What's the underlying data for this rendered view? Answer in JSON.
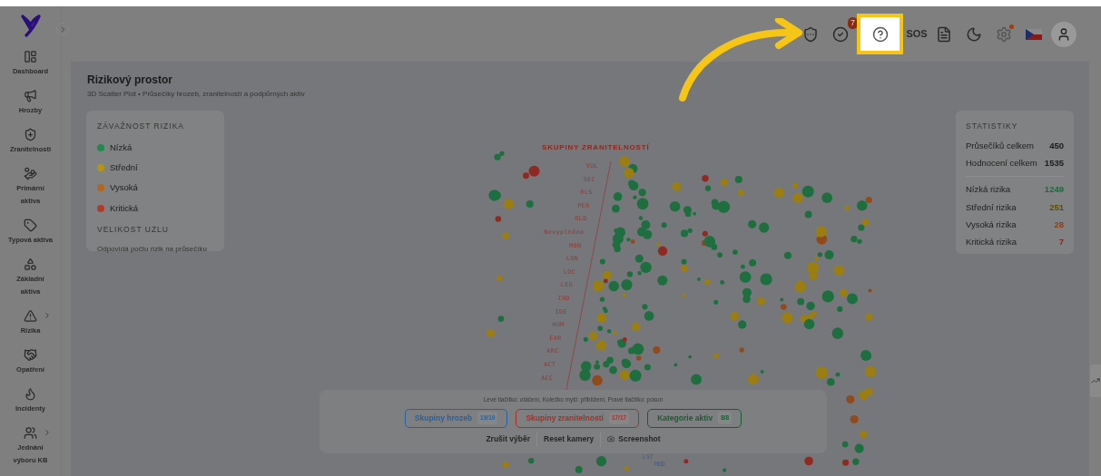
{
  "sidebar": {
    "items": [
      {
        "kind": "dashboard",
        "label": "Dashboard",
        "submenu": false
      },
      {
        "kind": "threats",
        "label": "Hrozby",
        "submenu": false
      },
      {
        "kind": "vulnerabilities",
        "label": "Zranitelnosti",
        "submenu": false
      },
      {
        "kind": "primary",
        "label": "Primární aktiva",
        "submenu": false
      },
      {
        "kind": "type",
        "label": "Typová aktiva",
        "submenu": false
      },
      {
        "kind": "basic",
        "label": "Základní aktiva",
        "submenu": false
      },
      {
        "kind": "risks",
        "label": "Rizika",
        "submenu": true
      },
      {
        "kind": "measures",
        "label": "Opatření",
        "submenu": false
      },
      {
        "kind": "incidents",
        "label": "Incidenty",
        "submenu": false
      },
      {
        "kind": "committee",
        "label": "Jednání výboru KB",
        "submenu": true
      }
    ]
  },
  "header": {
    "buttons": [
      {
        "kind": "security",
        "highlighted": false
      },
      {
        "kind": "tasks",
        "badge": "7",
        "highlighted": false
      },
      {
        "kind": "help",
        "highlighted": true
      },
      {
        "kind": "sos",
        "label": "SOS",
        "highlighted": false
      },
      {
        "kind": "pdf",
        "highlighted": false
      },
      {
        "kind": "theme",
        "highlighted": false
      },
      {
        "kind": "settings",
        "dot": true,
        "highlighted": false
      },
      {
        "kind": "language",
        "highlighted": false
      },
      {
        "kind": "user",
        "highlighted": false
      }
    ]
  },
  "page": {
    "title": "Rizikový prostor",
    "subtitle": "3D Scatter Plot • Průsečíky hrozeb, zranitelností a podpůrných aktiv"
  },
  "legend": {
    "title": "ZÁVAŽNOST RIZIKA",
    "items": [
      {
        "label": "Nízká",
        "color": "#1f8a4c"
      },
      {
        "label": "Střední",
        "color": "#b5940f"
      },
      {
        "label": "Vysoká",
        "color": "#b5651d"
      },
      {
        "label": "Kritická",
        "color": "#b03a2e"
      }
    ],
    "size_title": "VELIKOST UZLU",
    "size_text": "Odpovídá počtu rizik na průsečíku"
  },
  "stats": {
    "title": "STATISTIKY",
    "totals": [
      {
        "label": "Průsečíků celkem",
        "value": "450"
      },
      {
        "label": "Hodnocení celkem",
        "value": "1535"
      }
    ],
    "levels": [
      {
        "label": "Nízká rizika",
        "value": "1249",
        "color": "#1a6b3a"
      },
      {
        "label": "Střední rizika",
        "value": "251",
        "color": "#5e4c05"
      },
      {
        "label": "Vysoká rizika",
        "value": "28",
        "color": "#8a3f14"
      },
      {
        "label": "Kritická rizika",
        "value": "7",
        "color": "#8a1f1a"
      }
    ]
  },
  "plot": {
    "axis_title": "SKUPINY ZRANITELNOSTÍ",
    "axis_labels": [
      "VUL",
      "SEC",
      "RLS",
      "PER",
      "OLD",
      "Nevyplněno",
      "MON",
      "LON",
      "LOC",
      "LEG",
      "IND",
      "IDE",
      "HUM",
      "EAR",
      "ARC",
      "ACT",
      "ACC"
    ],
    "bottom_labels": [
      "LST",
      "MOD"
    ]
  },
  "controls": {
    "hint": "Levé tlačítko: otáčení, Kolečko myši: přiblížení, Pravé tlačítko: posun",
    "filters": [
      {
        "label": "Skupiny hrozeb",
        "count": "19/19",
        "color": "#2a5f9e"
      },
      {
        "label": "Skupiny zranitelností",
        "count": "17/17",
        "color": "#a3302a"
      },
      {
        "label": "Kategorie aktiv",
        "count": "8/8",
        "color": "#1a5c32"
      }
    ],
    "actions": [
      {
        "kind": "clear",
        "label": "Zrušit výběr"
      },
      {
        "kind": "reset",
        "label": "Reset kamery"
      },
      {
        "kind": "screenshot",
        "label": "Screenshot"
      }
    ]
  }
}
